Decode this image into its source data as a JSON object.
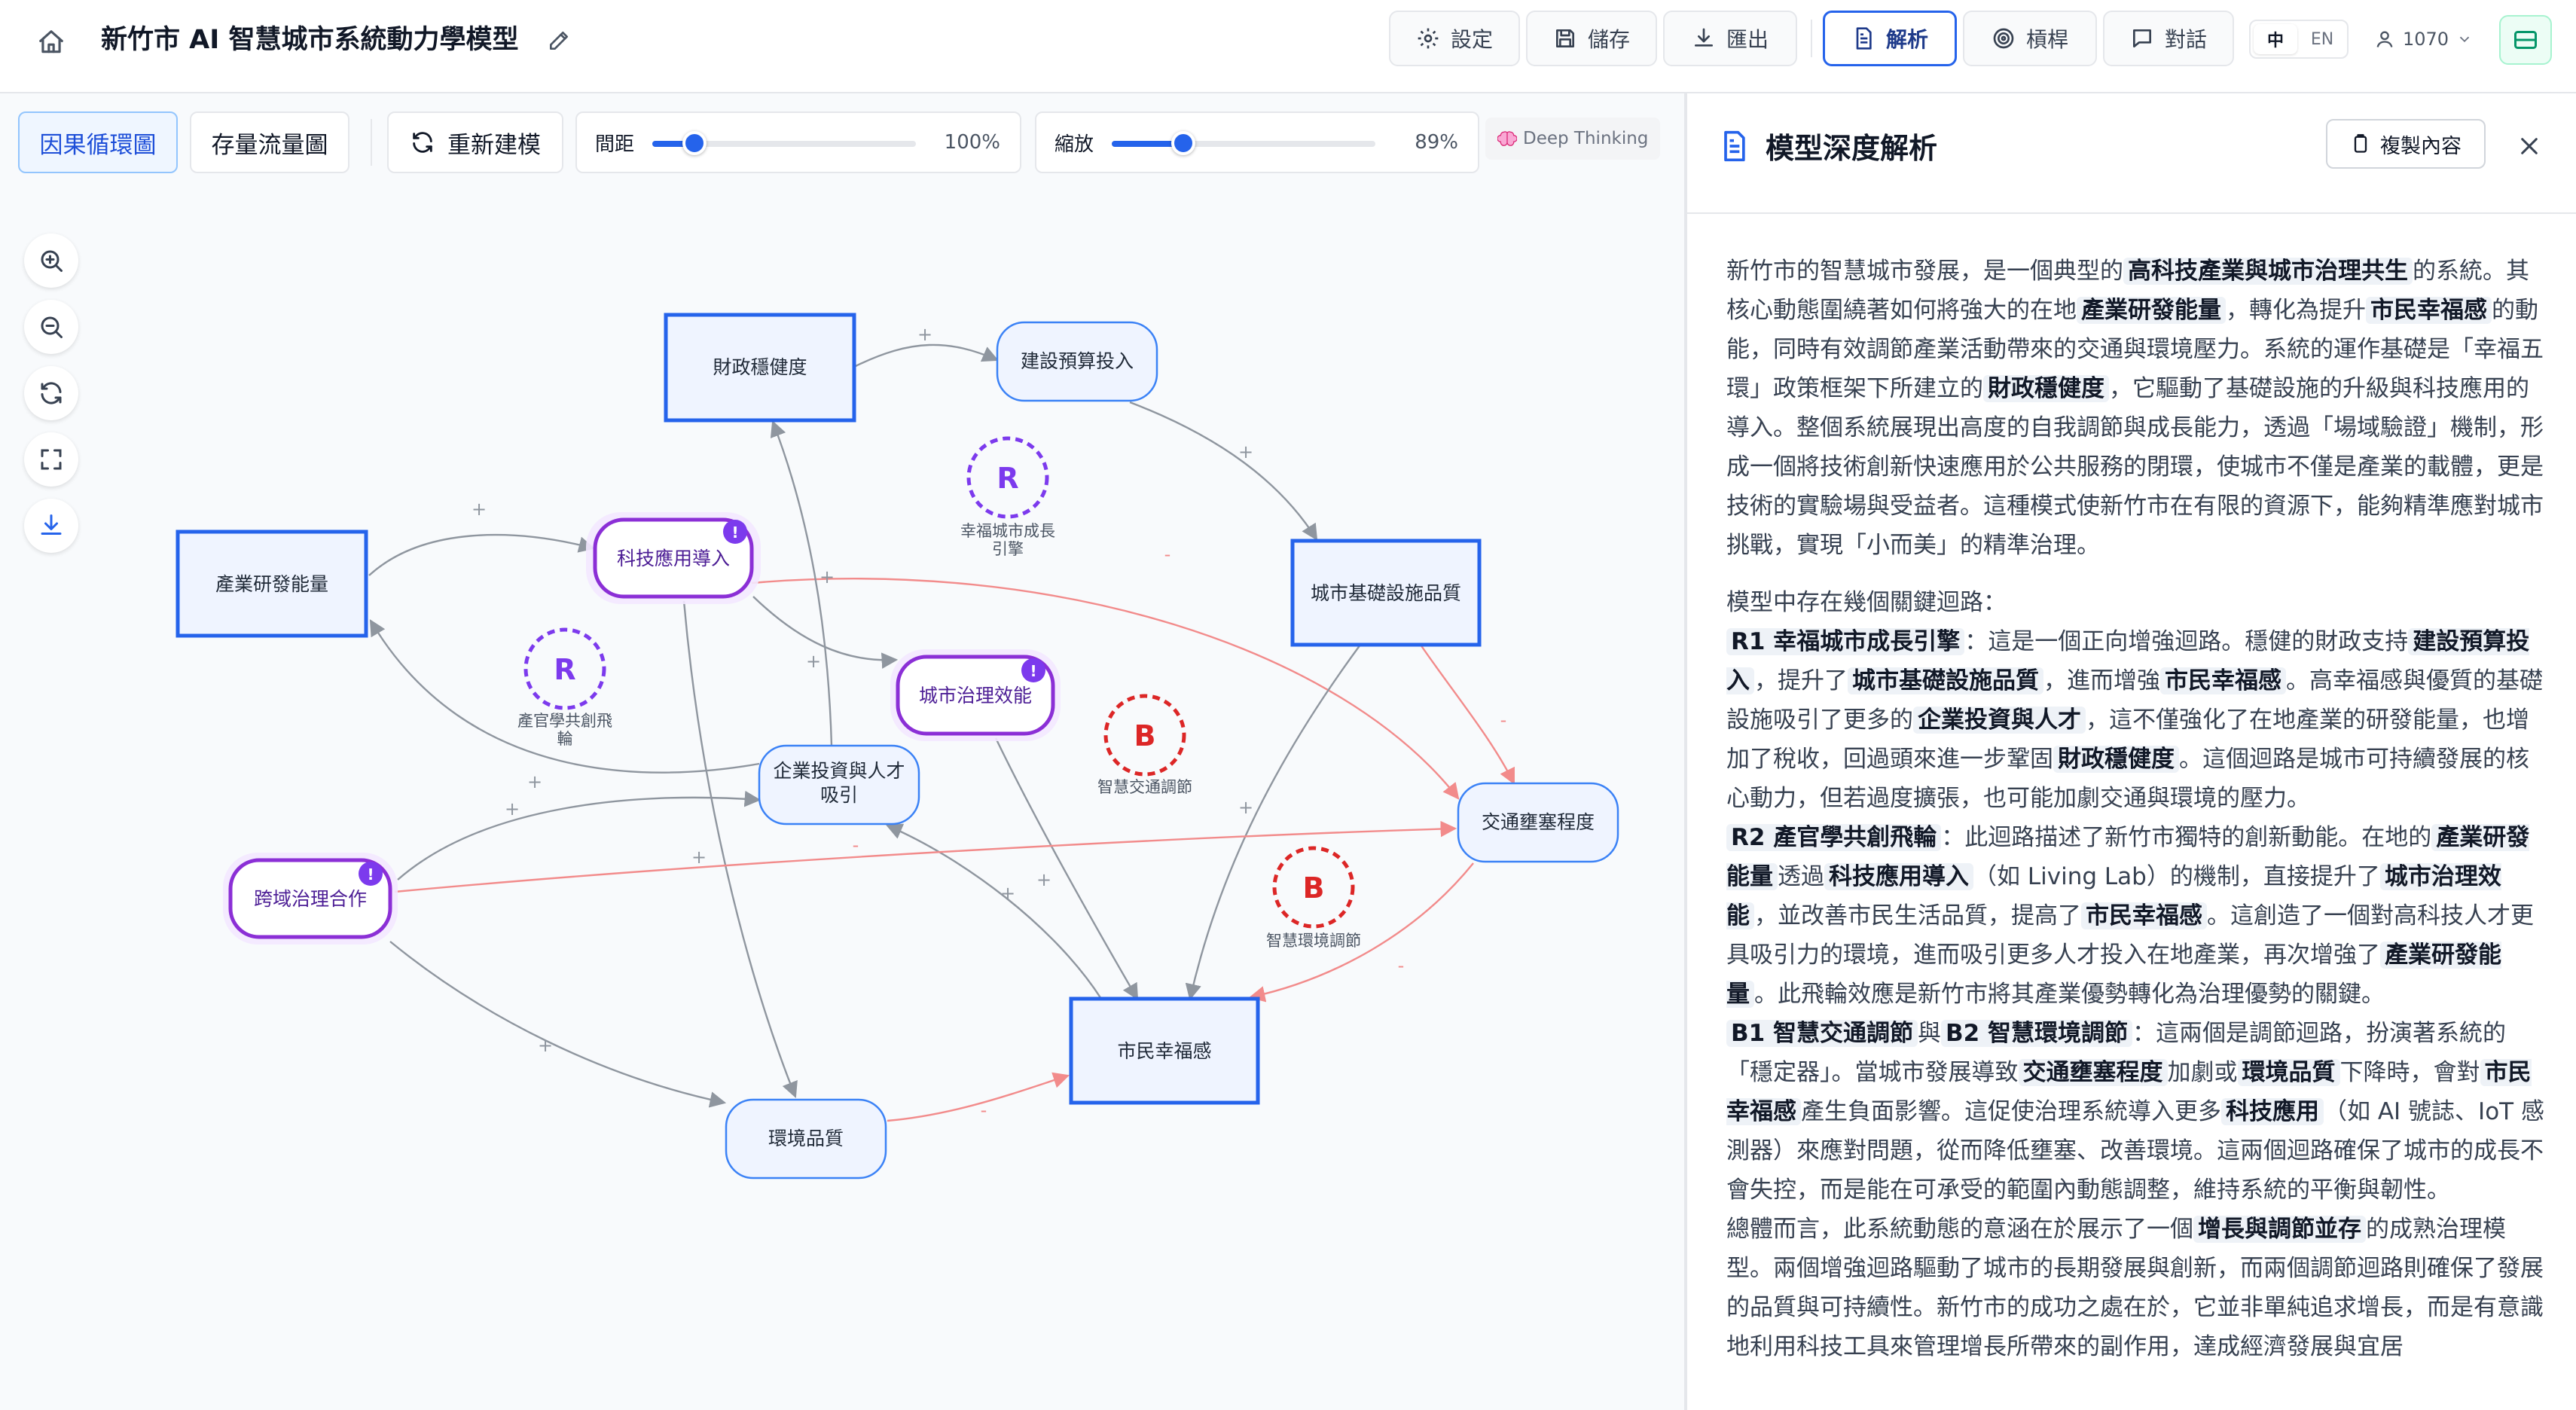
{
  "app": {
    "title": "新竹市 AI 智慧城市系統動力學模型"
  },
  "topbar": {
    "settings": "設定",
    "save": "儲存",
    "export": "匯出",
    "analyze": "解析",
    "lever": "槓桿",
    "chat": "對話",
    "lang_zh": "中",
    "lang_en": "EN",
    "credits": "1070"
  },
  "toolbar": {
    "tab_cld": "因果循環圖",
    "tab_sfd": "存量流量圖",
    "rebuild": "重新建模",
    "spacing_label": "間距",
    "spacing_value": "100%",
    "spacing_level": 0.16,
    "zoom_label": "縮放",
    "zoom_value": "89%",
    "zoom_level": 0.27,
    "deep_thinking": "Deep Thinking"
  },
  "diagram": {
    "nodes": [
      {
        "id": "n1",
        "label": "財政穩健度",
        "style": "stock"
      },
      {
        "id": "n2",
        "label": "建設預算投入",
        "style": "aux"
      },
      {
        "id": "n3",
        "label": "產業研發能量",
        "style": "stock"
      },
      {
        "id": "n4",
        "label": "科技應用導入",
        "style": "lever"
      },
      {
        "id": "n5",
        "label": "城市基礎設施品質",
        "style": "stock"
      },
      {
        "id": "n6",
        "label": "城市治理效能",
        "style": "lever"
      },
      {
        "id": "n7",
        "label": "企業投資與人才吸引",
        "style": "aux"
      },
      {
        "id": "n8",
        "label": "交通壅塞程度",
        "style": "aux"
      },
      {
        "id": "n9",
        "label": "跨域治理合作",
        "style": "lever"
      },
      {
        "id": "n10",
        "label": "市民幸福感",
        "style": "stock"
      },
      {
        "id": "n11",
        "label": "環境品質",
        "style": "aux"
      }
    ],
    "loops": [
      {
        "letter": "R",
        "label": "幸福城市成長引擎",
        "color": "#7c3aed"
      },
      {
        "letter": "R",
        "label": "產官學共創飛輪",
        "color": "#7c3aed"
      },
      {
        "letter": "B",
        "label": "智慧交通調節",
        "color": "#dc2626"
      },
      {
        "letter": "B",
        "label": "智慧環境調節",
        "color": "#dc2626"
      }
    ],
    "plus": "+",
    "minus": "-",
    "badge": "!"
  },
  "panel": {
    "title": "模型深度解析",
    "copy": "複製內容",
    "p1": [
      "新竹市的智慧城市發展，是一個典型的",
      "高科技產業與城市治理共生",
      "的系統。其核心動態圍繞著如何將強大的在地",
      "產業研發能量",
      "，轉化為提升",
      "市民幸福感",
      "的動能，同時有效調節產業活動帶來的交通與環境壓力。系統的運作基礎是「幸福五環」政策框架下所建立的",
      "財政穩健度",
      "，它驅動了基礎設施的升級與科技應用的導入。整個系統展現出高度的自我調節與成長能力，透過「場域驗證」機制，形成一個將技術創新快速應用於公共服務的閉環，使城市不僅是產業的載體，更是技術的實驗場與受益者。這種模式使新竹市在有限的資源下，能夠精準應對城市挑戰，實現「小而美」的精準治理。"
    ],
    "p2_intro": "模型中存在幾個關鍵迴路：",
    "p2_r1": [
      "R1 幸福城市成長引擎",
      "：這是一個正向增強迴路。穩健的財政支持",
      "建設預算投入",
      "，提升了",
      "城市基礎設施品質",
      "，進而增強",
      "市民幸福感",
      "。高幸福感與優質的基礎設施吸引了更多的",
      "企業投資與人才",
      "，這不僅強化了在地產業的研發能量，也增加了稅收，回過頭來進一步鞏固",
      "財政穩健度",
      "。這個迴路是城市可持續發展的核心動力，但若過度擴張，也可能加劇交通與環境的壓力。"
    ],
    "p2_r2": [
      "R2 產官學共創飛輪",
      "：此迴路描述了新竹市獨特的創新動能。在地的",
      "產業研發能量",
      "透過",
      "科技應用導入",
      "（如 Living Lab）的機制，直接提升了",
      "城市治理效能",
      "，並改善市民生活品質，提高了",
      "市民幸福感",
      "。這創造了一個對高科技人才更具吸引力的環境，進而吸引更多人才投入在地產業，再次增強了",
      "產業研發能量",
      "。此飛輪效應是新竹市將其產業優勢轉化為治理優勢的關鍵。"
    ],
    "p2_b": [
      "B1 智慧交通調節",
      "與",
      "B2 智慧環境調節",
      "：這兩個是調節迴路，扮演著系統的「穩定器」。當城市發展導致",
      "交通壅塞程度",
      "加劇或",
      "環境品質",
      "下降時，會對",
      "市民幸福感",
      "產生負面影響。這促使治理系統導入更多",
      "科技應用",
      "（如 AI 號誌、IoT 感測器）來應對問題，從而降低壅塞、改善環境。這兩個迴路確保了城市的成長不會失控，而是能在可承受的範圍內動態調整，維持系統的平衡與韌性。"
    ],
    "p3": [
      "總體而言，此系統動態的意涵在於展示了一個",
      "增長與調節並存",
      "的成熟治理模型。兩個增強迴路驅動了城市的長期發展與創新，而兩個調節迴路則確保了發展的品質與可持續性。新竹市的成功之處在於，它並非單純追求增長，而是有意識地利用科技工具來管理增長所帶來的副作用，達成經濟發展與宜居"
    ]
  }
}
